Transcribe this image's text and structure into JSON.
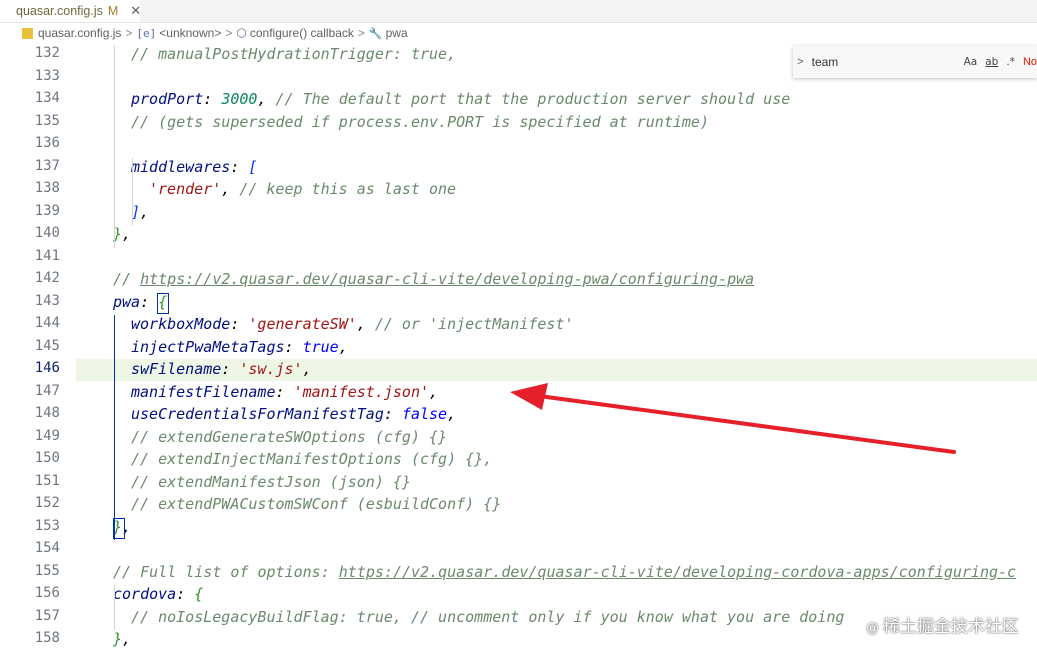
{
  "tab": {
    "title": "quasar.config.js",
    "modified": "M",
    "close_glyph": "✕"
  },
  "breadcrumb": {
    "file": "quasar.config.js",
    "unknown_label": "<unknown>",
    "unknown_icon": "[e]",
    "callback_label": "configure() callback",
    "pwa_label": "pwa",
    "sep": ">"
  },
  "find": {
    "toggle_glyph": ">",
    "value": "team",
    "opt_case": "Aa",
    "opt_word": "ab",
    "opt_regex": ".*",
    "result": "No"
  },
  "editor": {
    "active_line": 146,
    "lines": [
      {
        "num": "132",
        "indent": 1,
        "tokens": [
          [
            "com",
            "// manualPostHydrationTrigger: true,"
          ]
        ]
      },
      {
        "num": "133",
        "indent": 0,
        "tokens": []
      },
      {
        "num": "134",
        "indent": 1,
        "tokens": [
          [
            "key",
            "prodPort"
          ],
          [
            "punc",
            ": "
          ],
          [
            "num",
            "3000"
          ],
          [
            "punc",
            ", "
          ],
          [
            "com",
            "// The default port that the production server should use"
          ]
        ]
      },
      {
        "num": "135",
        "indent": 1,
        "tokens": [
          [
            "com",
            "// (gets superseded if process.env.PORT is specified at runtime)"
          ]
        ]
      },
      {
        "num": "136",
        "indent": 0,
        "tokens": []
      },
      {
        "num": "137",
        "indent": 1,
        "tokens": [
          [
            "key",
            "middlewares"
          ],
          [
            "punc",
            ": "
          ],
          [
            "brk2",
            "["
          ]
        ]
      },
      {
        "num": "138",
        "indent": 2,
        "tokens": [
          [
            "str",
            "'render'"
          ],
          [
            "punc",
            ", "
          ],
          [
            "com",
            "// keep this as last one"
          ]
        ]
      },
      {
        "num": "139",
        "indent": 1,
        "tokens": [
          [
            "brk2",
            "]"
          ],
          [
            "punc",
            ","
          ]
        ]
      },
      {
        "num": "140",
        "indent": 0,
        "tokens": [
          [
            "brk",
            "}"
          ],
          [
            "punc",
            ","
          ]
        ]
      },
      {
        "num": "141",
        "indent": 0,
        "tokens": []
      },
      {
        "num": "142",
        "indent": 0,
        "tokens": [
          [
            "com",
            "// "
          ],
          [
            "comlink",
            "https://v2.quasar.dev/quasar-cli-vite/developing-pwa/configuring-pwa"
          ]
        ]
      },
      {
        "num": "143",
        "indent": 0,
        "tokens": [
          [
            "key",
            "pwa"
          ],
          [
            "punc",
            ": "
          ],
          [
            "brk",
            "{"
          ]
        ]
      },
      {
        "num": "144",
        "indent": 1,
        "tokens": [
          [
            "key",
            "workboxMode"
          ],
          [
            "punc",
            ": "
          ],
          [
            "str",
            "'generateSW'"
          ],
          [
            "punc",
            ", "
          ],
          [
            "com",
            "// or 'injectManifest'"
          ]
        ]
      },
      {
        "num": "145",
        "indent": 1,
        "tokens": [
          [
            "key",
            "injectPwaMetaTags"
          ],
          [
            "punc",
            ": "
          ],
          [
            "bool",
            "true"
          ],
          [
            "punc",
            ","
          ]
        ]
      },
      {
        "num": "146",
        "indent": 1,
        "tokens": [
          [
            "key",
            "swFilename"
          ],
          [
            "punc",
            ": "
          ],
          [
            "str",
            "'sw.js'"
          ],
          [
            "punc",
            ","
          ]
        ]
      },
      {
        "num": "147",
        "indent": 1,
        "tokens": [
          [
            "key",
            "manifestFilename"
          ],
          [
            "punc",
            ": "
          ],
          [
            "str",
            "'manifest.json'"
          ],
          [
            "punc",
            ","
          ]
        ]
      },
      {
        "num": "148",
        "indent": 1,
        "tokens": [
          [
            "key",
            "useCredentialsForManifestTag"
          ],
          [
            "punc",
            ": "
          ],
          [
            "bool",
            "false"
          ],
          [
            "punc",
            ","
          ]
        ]
      },
      {
        "num": "149",
        "indent": 1,
        "tokens": [
          [
            "com",
            "// extendGenerateSWOptions (cfg) {}"
          ]
        ]
      },
      {
        "num": "150",
        "indent": 1,
        "tokens": [
          [
            "com",
            "// extendInjectManifestOptions (cfg) {},"
          ]
        ]
      },
      {
        "num": "151",
        "indent": 1,
        "tokens": [
          [
            "com",
            "// extendManifestJson (json) {}"
          ]
        ]
      },
      {
        "num": "152",
        "indent": 1,
        "tokens": [
          [
            "com",
            "// extendPWACustomSWConf (esbuildConf) {}"
          ]
        ]
      },
      {
        "num": "153",
        "indent": 0,
        "tokens": [
          [
            "brk",
            "}"
          ],
          [
            "punc",
            ","
          ]
        ]
      },
      {
        "num": "154",
        "indent": 0,
        "tokens": []
      },
      {
        "num": "155",
        "indent": 0,
        "tokens": [
          [
            "com",
            "// Full list of options: "
          ],
          [
            "comlink",
            "https://v2.quasar.dev/quasar-cli-vite/developing-cordova-apps/configuring-c"
          ]
        ]
      },
      {
        "num": "156",
        "indent": 0,
        "tokens": [
          [
            "key",
            "cordova"
          ],
          [
            "punc",
            ": "
          ],
          [
            "brk",
            "{"
          ]
        ]
      },
      {
        "num": "157",
        "indent": 1,
        "tokens": [
          [
            "com",
            "// noIosLegacyBuildFlag: true, // uncomment only if you know what you are doing"
          ]
        ]
      },
      {
        "num": "158",
        "indent": 0,
        "tokens": [
          [
            "brk",
            "}"
          ],
          [
            "punc",
            ","
          ]
        ]
      }
    ]
  },
  "colors": {
    "arrow": "#e5202a",
    "active_line_bg": "#eef7e6",
    "string": "#a31515",
    "comment": "#6a8a6a",
    "keyword": "#001080"
  },
  "watermark": {
    "text": "稀土掘金技术社区",
    "glyph": "@"
  }
}
